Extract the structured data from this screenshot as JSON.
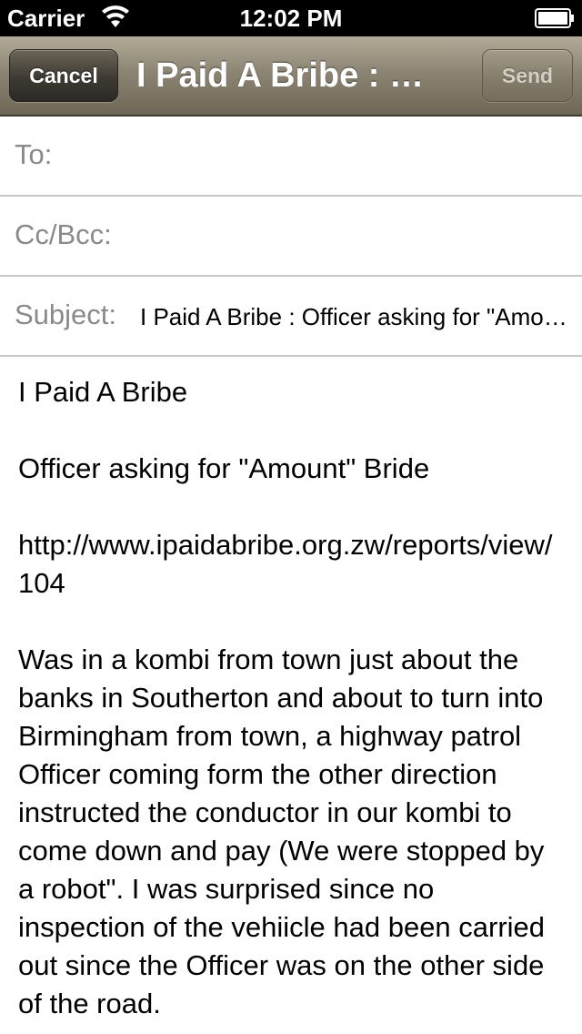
{
  "status_bar": {
    "carrier": "Carrier",
    "time": "12:02 PM"
  },
  "nav": {
    "cancel_label": "Cancel",
    "title": "I Paid A Bribe : Officer asking for \"Amount\" Bride",
    "send_label": "Send"
  },
  "fields": {
    "to_label": "To:",
    "to_value": "",
    "cc_label": "Cc/Bcc:",
    "cc_value": "",
    "subject_label": "Subject:",
    "subject_value": "I Paid A Bribe : Officer asking for \"Amount\" Bride"
  },
  "body": {
    "heading": "I Paid A Bribe",
    "report_title": "Officer asking for \"Amount\" Bride",
    "url": "http://www.ipaidabribe.org.zw/reports/view/104",
    "text": "Was in a kombi from town just about the banks in Southerton and about to turn into Birmingham from town, a highway patrol Officer coming form the other direction instructed the conductor in our kombi to come down and pay (We were stopped by a robot\". I was surprised since no inspection of the vehiicle had been carried out since the Officer was on the other side of the road."
  },
  "colors": {
    "nav_bar": "#8d8574",
    "label_gray": "#8a8a8a",
    "separator": "#c8c8c8"
  }
}
